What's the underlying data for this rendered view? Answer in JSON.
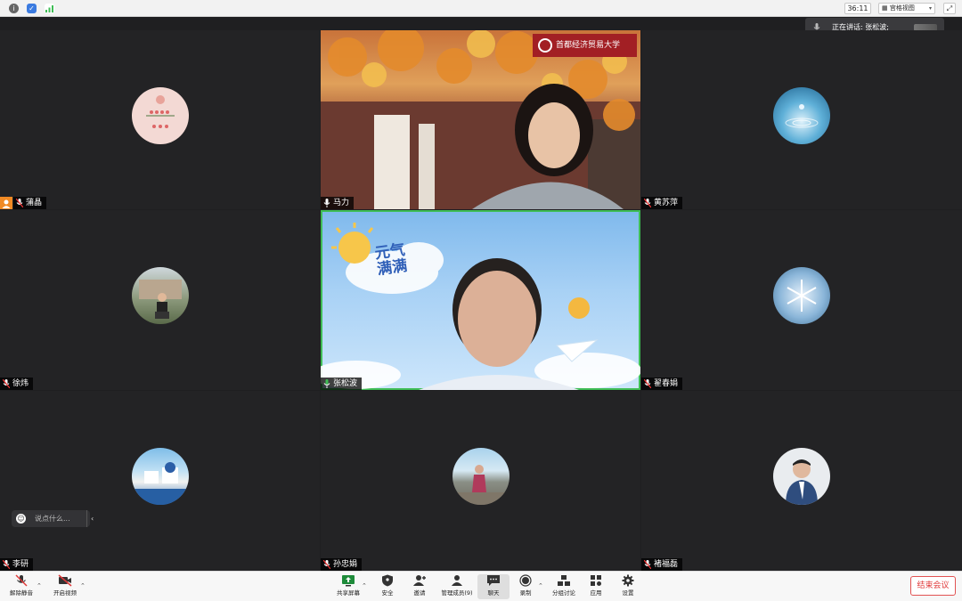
{
  "topbar": {
    "timer": "36:11",
    "view_label": "宫格视图",
    "view_chevron": "▾"
  },
  "speaking": {
    "text": "正在讲话: 张松波;"
  },
  "participants": [
    {
      "name": "蒲晶"
    },
    {
      "name": "马力",
      "school": "首都经济贸易大学"
    },
    {
      "name": "黄苏萍"
    },
    {
      "name": "徐炜"
    },
    {
      "name": "张松波",
      "sticker_text_1": "元气",
      "sticker_text_2": "满满"
    },
    {
      "name": "翟春娟"
    },
    {
      "name": "李研"
    },
    {
      "name": "孙忠娟"
    },
    {
      "name": "褚福磊"
    }
  ],
  "chat": {
    "placeholder": "说点什么..."
  },
  "toolbar": {
    "unmute": "解除静音",
    "start_video": "开启视频",
    "share": "共享屏幕",
    "security": "安全",
    "invite": "邀请",
    "manage": "管理成员(9)",
    "chat": "聊天",
    "record": "录制",
    "breakout": "分组讨论",
    "apps": "应用",
    "settings": "设置",
    "end": "结束会议"
  },
  "colors": {
    "active_border": "#3fbd55",
    "end_red": "#e03a3a",
    "host_orange": "#f08a24"
  }
}
